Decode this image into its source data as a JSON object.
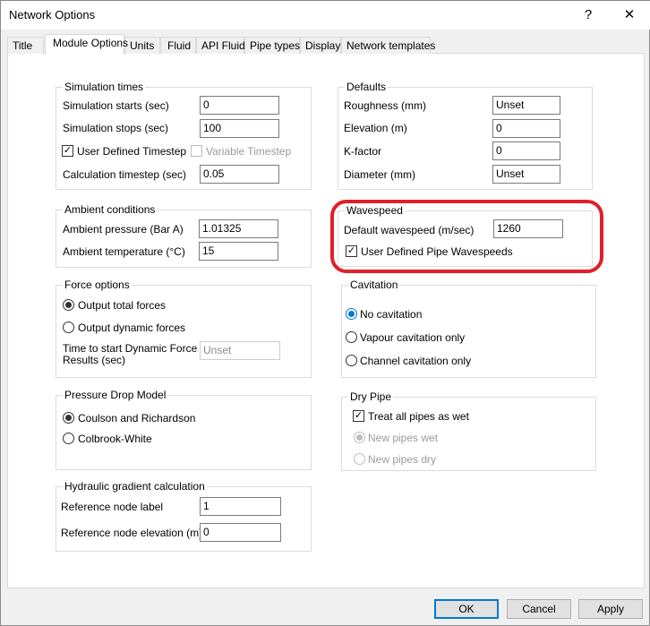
{
  "window": {
    "title": "Network Options",
    "help_glyph": "?",
    "close_glyph": "✕"
  },
  "tabs": [
    "Title",
    "Module Options",
    "Units",
    "Fluid",
    "API Fluid",
    "Pipe types",
    "Display",
    "Network templates"
  ],
  "active_tab": "Module Options",
  "simulation_times": {
    "title": "Simulation times",
    "starts_label": "Simulation starts (sec)",
    "starts_value": "0",
    "stops_label": "Simulation stops (sec)",
    "stops_value": "100",
    "user_defined_timestep": "User Defined Timestep",
    "user_defined_checked": true,
    "variable_timestep": "Variable Timestep",
    "variable_checked": false,
    "calc_label": "Calculation timestep (sec)",
    "calc_value": "0.05"
  },
  "ambient": {
    "title": "Ambient conditions",
    "pressure_label": "Ambient pressure (Bar A)",
    "pressure_value": "1.01325",
    "temp_label": "Ambient temperature (°C)",
    "temp_value": "15"
  },
  "force": {
    "title": "Force options",
    "total": "Output total forces",
    "dynamic": "Output dynamic forces",
    "selected": "total",
    "start_label_1": "Time to start Dynamic Force",
    "start_label_2": "Results (sec)",
    "start_value": "Unset"
  },
  "pressure_drop": {
    "title": "Pressure Drop Model",
    "opt1": "Coulson and Richardson",
    "opt2": "Colbrook-White",
    "selected": "opt1"
  },
  "hydraulic": {
    "title": "Hydraulic gradient calculation",
    "node_label": "Reference node label",
    "node_value": "1",
    "elev_label": "Reference node elevation (m)",
    "elev_value": "0"
  },
  "defaults": {
    "title": "Defaults",
    "roughness_label": "Roughness (mm)",
    "roughness_value": "Unset",
    "elevation_label": "Elevation (m)",
    "elevation_value": "0",
    "kfactor_label": "K-factor",
    "kfactor_value": "0",
    "diameter_label": "Diameter (mm)",
    "diameter_value": "Unset"
  },
  "wavespeed": {
    "title": "Wavespeed",
    "default_label": "Default wavespeed (m/sec)",
    "default_value": "1260",
    "user_defined": "User Defined Pipe Wavespeeds",
    "user_defined_checked": true,
    "highlight_color": "#e0202a"
  },
  "cavitation": {
    "title": "Cavitation",
    "opt1": "No cavitation",
    "opt2": "Vapour cavitation only",
    "opt3": "Channel cavitation only",
    "selected": "opt1"
  },
  "dry_pipe": {
    "title": "Dry Pipe",
    "treat_wet": "Treat all pipes as wet",
    "treat_wet_checked": true,
    "new_wet": "New pipes wet",
    "new_dry": "New pipes dry"
  },
  "buttons": {
    "ok": "OK",
    "cancel": "Cancel",
    "apply": "Apply"
  }
}
